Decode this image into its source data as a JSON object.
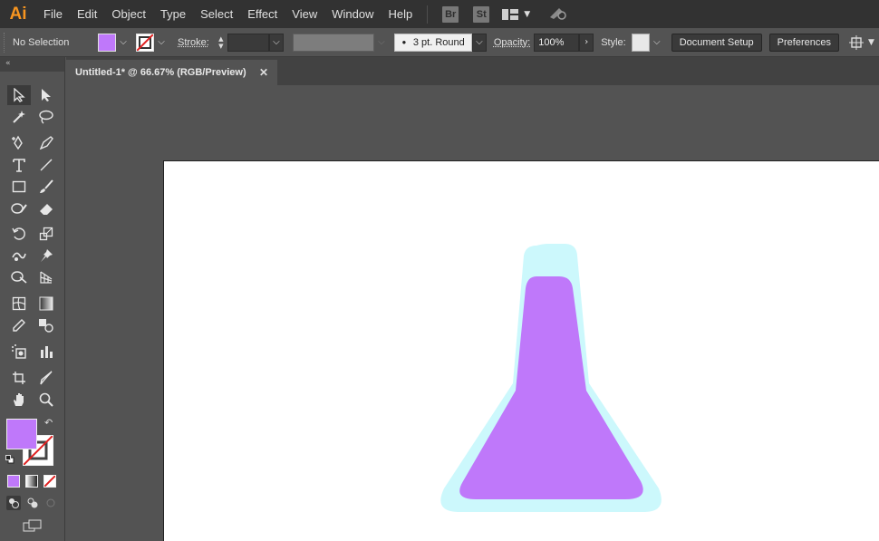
{
  "app": {
    "logo": "Ai",
    "menu": [
      "File",
      "Edit",
      "Object",
      "Type",
      "Select",
      "Effect",
      "View",
      "Window",
      "Help"
    ],
    "bridge_label": "Br",
    "stock_label": "St"
  },
  "control": {
    "selection_status": "No Selection",
    "stroke_label": "Stroke:",
    "brush_value": "3 pt. Round",
    "opacity_label": "Opacity:",
    "opacity_value": "100%",
    "style_label": "Style:",
    "document_setup": "Document Setup",
    "preferences": "Preferences"
  },
  "document": {
    "tab_title": "Untitled-1* @ 66.67% (RGB/Preview)",
    "close_glyph": "✕"
  },
  "colors": {
    "fill": "#bf78fa",
    "flask_outer": "#ccf8fc",
    "flask_inner": "#bf78fa",
    "accent_logo": "#f79520"
  }
}
